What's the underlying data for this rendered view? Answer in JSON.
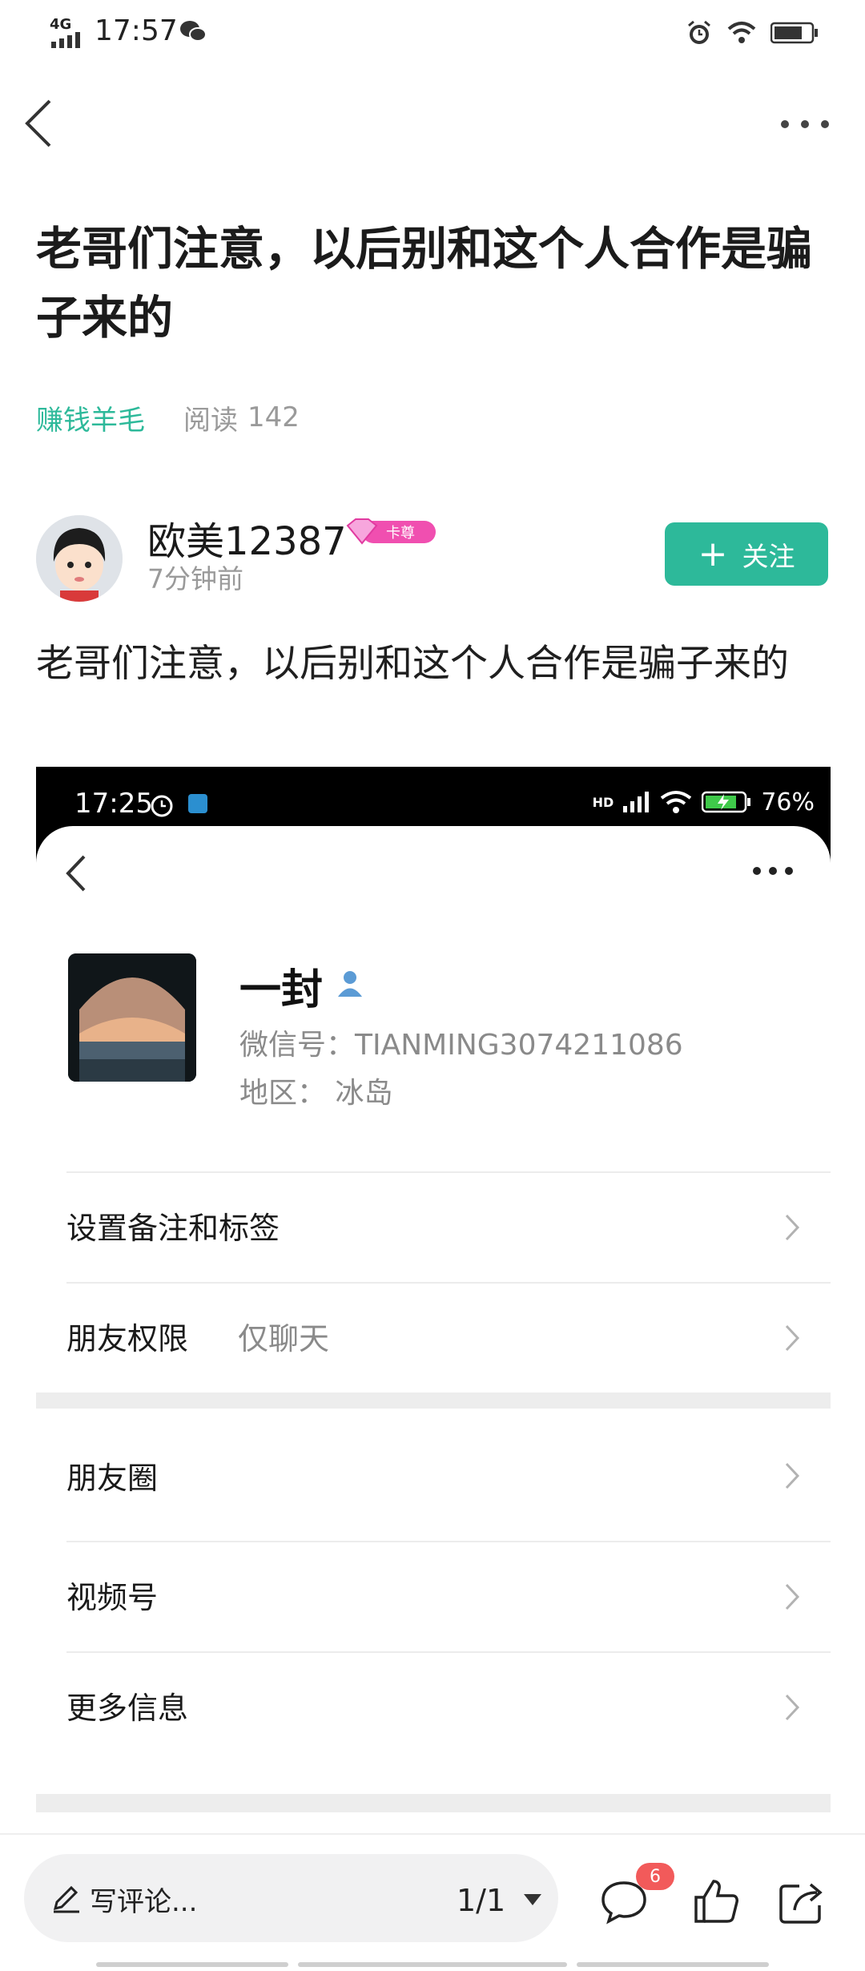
{
  "status_bar": {
    "network": "4G",
    "time": "17:57"
  },
  "article": {
    "title": "老哥们注意，以后别和这个人合作是骗子来的",
    "category": "赚钱羊毛",
    "read_label": "阅读",
    "read_count": "142",
    "body": "老哥们注意，以后别和这个人合作是骗子来的"
  },
  "author": {
    "name": "欧美12387",
    "badge": "卡尊",
    "time_ago": "7分钟前",
    "follow_label": "关注"
  },
  "embedded_screenshot": {
    "status_time": "17:25",
    "battery": "76%",
    "signal_label": "HD",
    "contact": {
      "name": "一封",
      "wechat_id": "微信号：TIANMING3074211086",
      "region": "地区：  冰岛"
    },
    "rows": {
      "remark": "设置备注和标签",
      "permission_label": "朋友权限",
      "permission_value": "仅聊天",
      "moments": "朋友圈",
      "channels": "视频号",
      "more_info": "更多信息"
    }
  },
  "bottom_bar": {
    "comment_placeholder": "写评论...",
    "page_indicator": "1/1",
    "comment_count": "6"
  },
  "colors": {
    "accent": "#2db99a",
    "badge_red": "#f25a5a",
    "vip_pink": "#f04fb0"
  }
}
